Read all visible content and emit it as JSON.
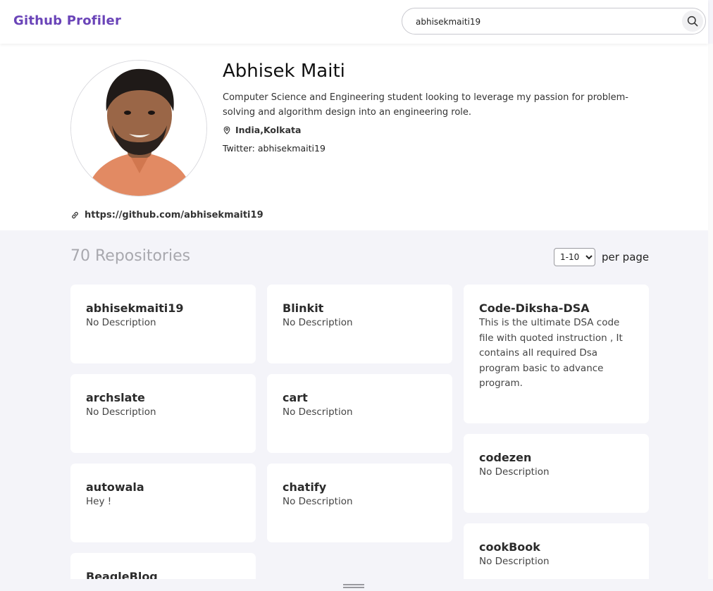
{
  "header": {
    "brand": "Github Profiler",
    "search_value": "abhisekmaiti19",
    "search_icon": "search-icon"
  },
  "profile": {
    "name": "Abhisek Maiti",
    "bio": "Computer Science and Engineering student looking to leverage my passion for problem-solving and algorithm design into an engineering role.",
    "location": "India,Kolkata",
    "twitter_label": "Twitter:",
    "twitter_handle": "abhisekmaiti19",
    "github_url": "https://github.com/abhisekmaiti19"
  },
  "repos": {
    "count_text": "70 Repositories",
    "per_page_selected": "1-10",
    "per_page_label": "per page",
    "items": [
      {
        "name": "abhisekmaiti19",
        "description": "No Description"
      },
      {
        "name": "Blinkit",
        "description": "No Description"
      },
      {
        "name": "Code-Diksha-DSA",
        "description": "This is the ultimate DSA code file with quoted instruction , It contains all required Dsa program basic to advance program."
      },
      {
        "name": "archslate",
        "description": "No Description"
      },
      {
        "name": "cart",
        "description": "No Description"
      },
      {
        "name": "codezen",
        "description": "No Description"
      },
      {
        "name": "autowala",
        "description": "Hey !"
      },
      {
        "name": "chatify",
        "description": "No Description"
      },
      {
        "name": "cookBook",
        "description": "No Description"
      },
      {
        "name": "BeagleBlog",
        "description": ""
      }
    ]
  },
  "colors": {
    "brand": "#6a44b8",
    "page_background": "#f4f4f9",
    "card_background": "#ffffff"
  }
}
